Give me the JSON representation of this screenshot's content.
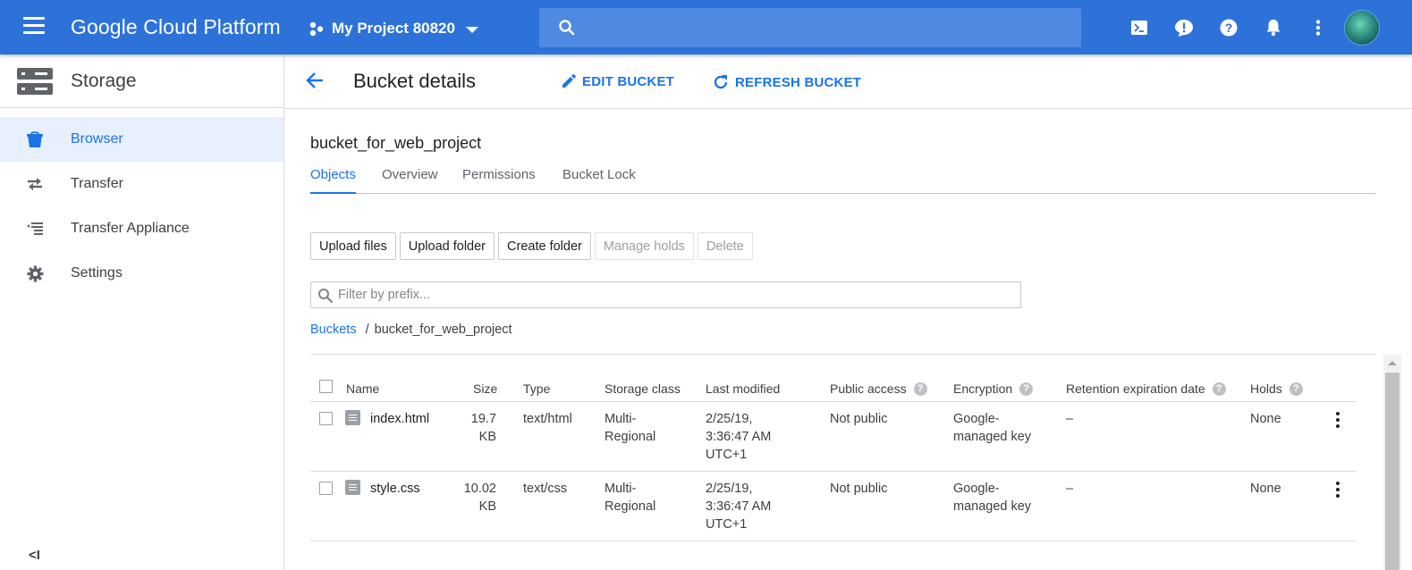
{
  "topbar": {
    "brand": "Google Cloud Platform",
    "project": "My Project 80820",
    "icons": [
      "cloud-shell-icon",
      "feedback-icon",
      "help-icon",
      "notifications-icon",
      "more-vert-icon"
    ]
  },
  "sidebar": {
    "title": "Storage",
    "items": [
      {
        "label": "Browser",
        "icon": "bucket-icon",
        "active": true
      },
      {
        "label": "Transfer",
        "icon": "transfer-icon"
      },
      {
        "label": "Transfer Appliance",
        "icon": "appliance-list-icon"
      },
      {
        "label": "Settings",
        "icon": "gear-icon"
      }
    ],
    "collapse": "<I"
  },
  "header": {
    "title": "Bucket details",
    "edit_label": "EDIT BUCKET",
    "refresh_label": "REFRESH BUCKET"
  },
  "bucket": {
    "name": "bucket_for_web_project",
    "tabs": [
      "Objects",
      "Overview",
      "Permissions",
      "Bucket Lock"
    ],
    "active_tab": "Objects"
  },
  "actions": {
    "upload_files": "Upload files",
    "upload_folder": "Upload folder",
    "create_folder": "Create folder",
    "manage_holds": "Manage holds",
    "delete": "Delete"
  },
  "filter": {
    "placeholder": "Filter by prefix..."
  },
  "breadcrumb": {
    "root": "Buckets",
    "separator": "/",
    "current": "bucket_for_web_project"
  },
  "table": {
    "columns": {
      "name": "Name",
      "size": "Size",
      "type": "Type",
      "storage_class": "Storage class",
      "last_modified": "Last modified",
      "public_access": "Public access",
      "encryption": "Encryption",
      "retention": "Retention expiration date",
      "holds": "Holds"
    },
    "rows": [
      {
        "name": "index.html",
        "size_num": "19.7",
        "size_unit": "KB",
        "type": "text/html",
        "class_1": "Multi-",
        "class_2": "Regional",
        "mod_1": "2/25/19,",
        "mod_2": "3:36:47 AM",
        "mod_3": "UTC+1",
        "public": "Not public",
        "enc_1": "Google-",
        "enc_2": "managed key",
        "retention": "–",
        "holds": "None"
      },
      {
        "name": "style.css",
        "size_num": "10.02",
        "size_unit": "KB",
        "type": "text/css",
        "class_1": "Multi-",
        "class_2": "Regional",
        "mod_1": "2/25/19,",
        "mod_2": "3:36:47 AM",
        "mod_3": "UTC+1",
        "public": "Not public",
        "enc_1": "Google-",
        "enc_2": "managed key",
        "retention": "–",
        "holds": "None"
      }
    ]
  },
  "colors": {
    "topbar": "#2d72d9",
    "accent": "#1a73e8",
    "active_nav_bg": "#e8f0fe"
  }
}
